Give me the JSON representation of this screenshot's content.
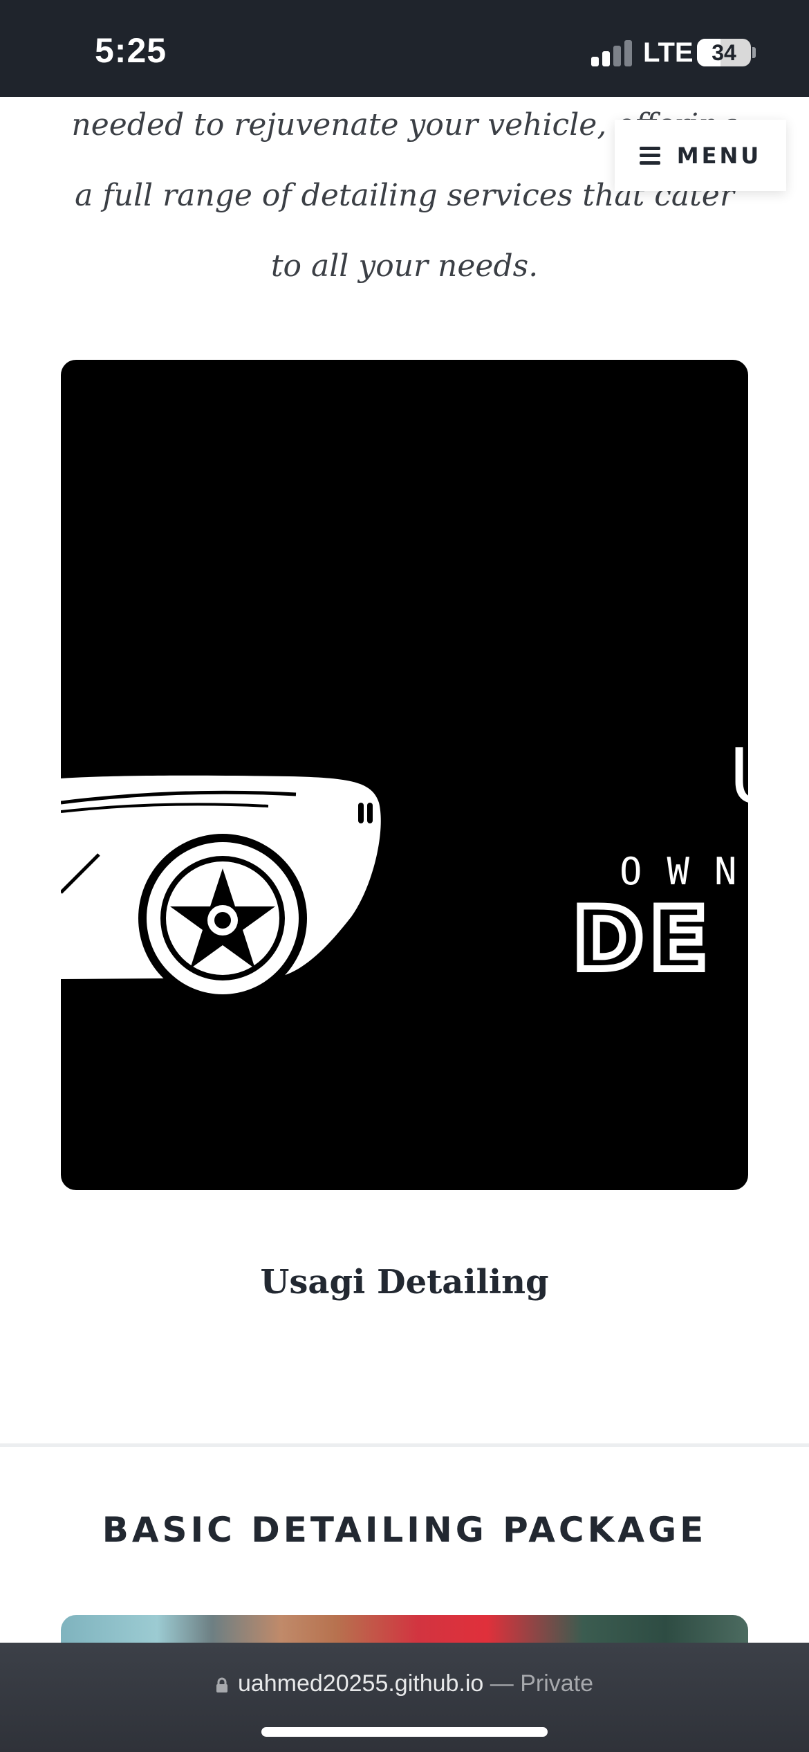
{
  "status_bar": {
    "time": "5:25",
    "network": "LTE",
    "battery": "34",
    "icons": [
      "signal-bars-icon",
      "battery-icon"
    ]
  },
  "header": {
    "menu_label": "MENU",
    "menu_icon": "hamburger-icon"
  },
  "intro": {
    "text": "needed to rejuvenate your vehicle, offering a full range of detailing services that cater to all your needs."
  },
  "logo_card": {
    "logo_text_line1": "OWN",
    "logo_text_line2": "DE",
    "logo_initial": "U",
    "title": "Usagi Detailing"
  },
  "section": {
    "heading": "BASIC DETAILING PACKAGE"
  },
  "browser": {
    "domain": "uahmed20255.github.io",
    "privacy": "— Private",
    "lock_icon": "lock-icon"
  },
  "colors": {
    "status_bg": "#1f242c",
    "text_dark": "#222831",
    "logo_bg": "#000000"
  }
}
